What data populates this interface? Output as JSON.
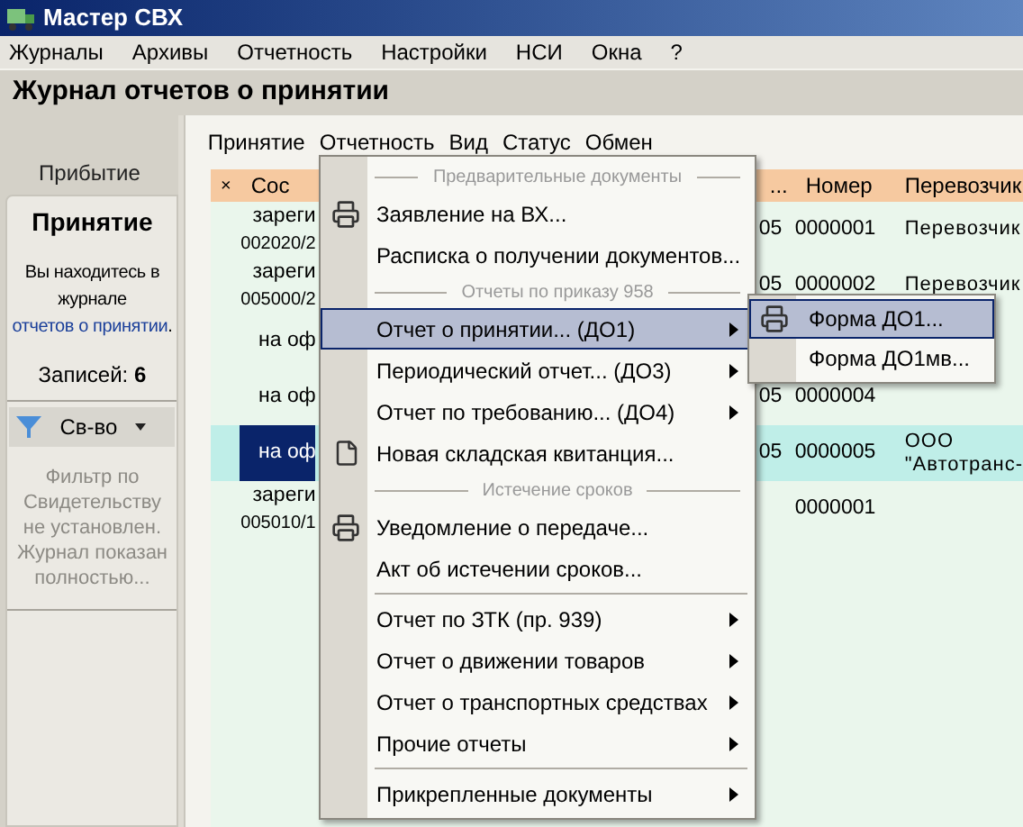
{
  "window": {
    "title": "Мастер СВХ"
  },
  "menubar": [
    "Журналы",
    "Архивы",
    "Отчетность",
    "Настройки",
    "НСИ",
    "Окна",
    "?"
  ],
  "journal_title": "Журнал отчетов о принятии",
  "side_tabs": [
    {
      "label": "Прибытие",
      "selected": false
    },
    {
      "label": "Принятие",
      "selected": true
    }
  ],
  "info": {
    "text": "Вы находитесь в журнале",
    "link": "отчетов о принятии",
    "end": "."
  },
  "records": "Записей: **6**",
  "filter_button": "Св-во",
  "filter_note": "Фильтр по Свидетельству не установлен. Журнал показан полностью...",
  "toolbar": [
    "Принятие",
    "Отчетность",
    "Вид",
    "Статус",
    "Обмен"
  ],
  "table": {
    "columns": [
      "×",
      "Сос",
      "...",
      "Номер",
      "Перевозчик"
    ],
    "rows": [
      {
        "status": "зареги",
        "doc": "002020/2",
        "col3": "05",
        "number": "0000001",
        "carrier": "Перевозчик",
        "selected": false
      },
      {
        "status": "зареги",
        "doc": "005000/2",
        "col3": "05",
        "number": "0000002",
        "carrier": "Перевозчик",
        "selected": false
      },
      {
        "status": "на оф",
        "selected": false
      },
      {
        "status": "на оф",
        "col3": "05",
        "number": "0000004",
        "selected": false
      },
      {
        "status": "на оф",
        "col3": "05",
        "number": "0000005",
        "carrier": "ООО \"Автотранс-",
        "selected": true
      },
      {
        "status": "зареги",
        "doc": "005010/1",
        "number": "0000001",
        "selected": false
      }
    ]
  },
  "menu": [
    {
      "kind": "header",
      "label": "Предварительные документы"
    },
    {
      "kind": "print",
      "label": "Заявление на ВХ...",
      "submenu": false,
      "selected": false
    },
    {
      "kind": "item",
      "label": "Расписка о получении документов...",
      "submenu": false,
      "selected": false
    },
    {
      "kind": "header",
      "label": "Отчеты по приказу 958"
    },
    {
      "kind": "item",
      "label": "Отчет о принятии... (ДО1)",
      "submenu": true,
      "selected": true
    },
    {
      "kind": "item",
      "label": "Периодический отчет... (ДО3)",
      "submenu": true,
      "selected": false
    },
    {
      "kind": "item",
      "label": "Отчет по требованию... (ДО4)",
      "submenu": true,
      "selected": false
    },
    {
      "kind": "file",
      "label": "Новая складская квитанция...",
      "submenu": false,
      "selected": false
    },
    {
      "kind": "header",
      "label": "Истечение сроков"
    },
    {
      "kind": "print",
      "label": "Уведомление о передаче...",
      "submenu": false,
      "selected": false
    },
    {
      "kind": "item",
      "label": "Акт об истечении сроков...",
      "submenu": false,
      "selected": false
    },
    {
      "kind": "separator"
    },
    {
      "kind": "item",
      "label": "Отчет по ЗТК (пр. 939)",
      "submenu": true,
      "selected": false
    },
    {
      "kind": "item",
      "label": "Отчет о движении товаров",
      "submenu": true,
      "selected": false
    },
    {
      "kind": "item",
      "label": "Отчет о транспортных средствах",
      "submenu": true,
      "selected": false
    },
    {
      "kind": "item",
      "label": "Прочие отчеты",
      "submenu": true,
      "selected": false
    },
    {
      "kind": "separator"
    },
    {
      "kind": "item",
      "label": "Прикрепленные документы",
      "submenu": true,
      "selected": false
    }
  ],
  "submenu": [
    {
      "kind": "print",
      "label": "Форма ДО1...",
      "selected": true
    },
    {
      "kind": "item",
      "label": "Форма ДО1мв...",
      "selected": false
    }
  ]
}
